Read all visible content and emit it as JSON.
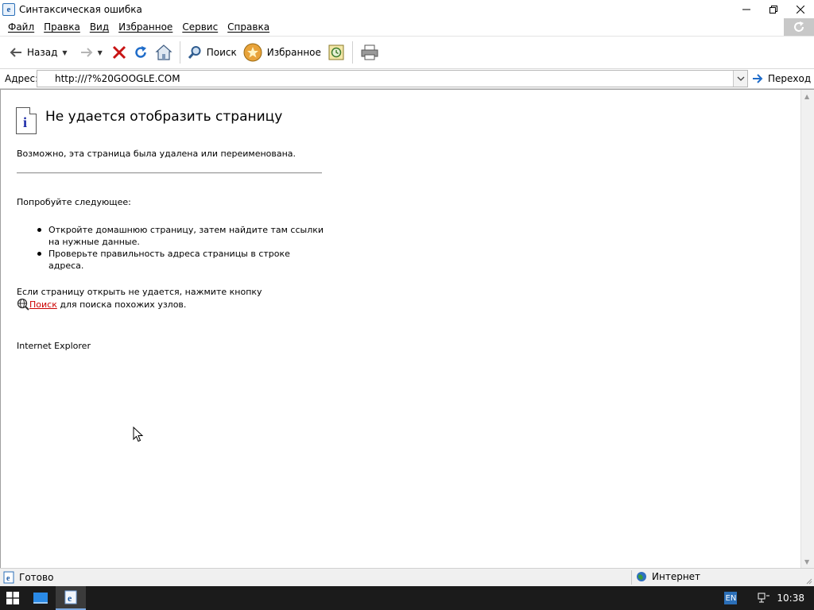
{
  "window": {
    "title": "Синтаксическая ошибка",
    "icon": "ie-page-icon",
    "controls": [
      "minimize-icon",
      "restore-icon",
      "close-icon"
    ]
  },
  "menu": {
    "items": [
      "Файл",
      "Правка",
      "Вид",
      "Избранное",
      "Сервис",
      "Справка"
    ]
  },
  "toolbar": {
    "back_label": "Назад",
    "search_label": "Поиск",
    "favorites_label": "Избранное"
  },
  "address": {
    "label": "Адрес:",
    "value": "http:///?%20GOOGLE.COM",
    "go_label": "Переход"
  },
  "page": {
    "title": "Не удается отобразить страницу",
    "subtitle": "Возможно, эта страница была удалена или переименована.",
    "try_heading": "Попробуйте следующее:",
    "suggestions": [
      "Откройте домашнюю страницу, затем найдите там ссылки на нужные данные.",
      "Проверьте правильность адреса страницы в строке адреса."
    ],
    "help_line1": "Если страницу открыть не удается, нажмите кнопку",
    "help_link": "Поиск",
    "help_line2_rest": " для поиска похожих узлов.",
    "footer": "Internet Explorer"
  },
  "status": {
    "left": "Готово",
    "zone": "Интернет"
  },
  "taskbar": {
    "language": "EN",
    "time": "10:38"
  },
  "colors": {
    "link": "#cc0000",
    "info_icon": "#1b2aa8",
    "taskbar": "#1b1b1b"
  }
}
